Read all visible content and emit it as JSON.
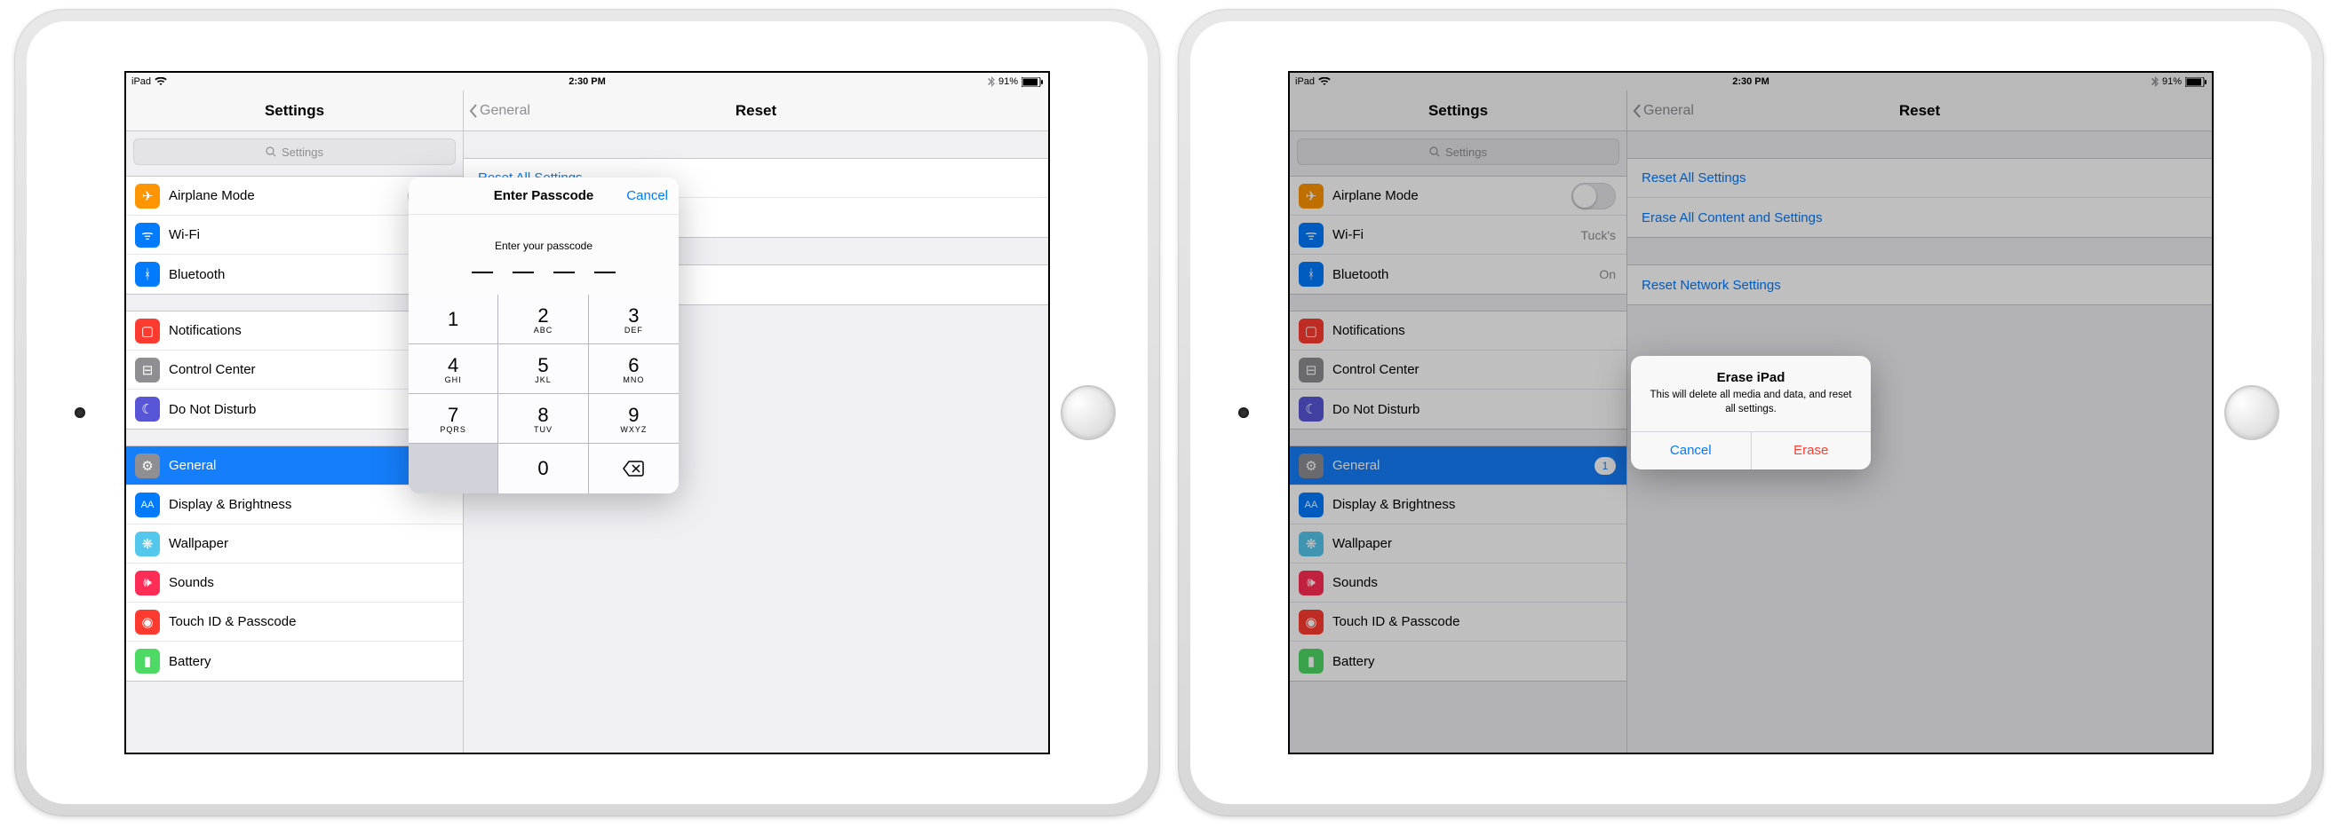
{
  "status": {
    "carrier": "iPad",
    "time": "2:30 PM",
    "battery": "91%"
  },
  "sidebar": {
    "title": "Settings",
    "search_placeholder": "Settings",
    "groups": [
      {
        "items": [
          {
            "icon": "airplane",
            "label": "Airplane Mode",
            "accessory": "switch"
          },
          {
            "icon": "wifi",
            "label": "Wi-Fi",
            "detail": "Tuck's"
          },
          {
            "icon": "bluetooth",
            "label": "Bluetooth",
            "detail": "On"
          }
        ]
      },
      {
        "items": [
          {
            "icon": "notif",
            "label": "Notifications"
          },
          {
            "icon": "control",
            "label": "Control Center"
          },
          {
            "icon": "dnd",
            "label": "Do Not Disturb"
          }
        ]
      },
      {
        "items": [
          {
            "icon": "general",
            "label": "General",
            "selected": true,
            "badge": "1"
          },
          {
            "icon": "display",
            "label": "Display & Brightness"
          },
          {
            "icon": "wallpaper",
            "label": "Wallpaper"
          },
          {
            "icon": "sounds",
            "label": "Sounds"
          },
          {
            "icon": "touchid",
            "label": "Touch ID & Passcode"
          },
          {
            "icon": "battery",
            "label": "Battery"
          }
        ]
      }
    ]
  },
  "main": {
    "back": "General",
    "title": "Reset",
    "sections": [
      [
        "Reset All Settings",
        "Erase All Content and Settings"
      ],
      [
        "Reset Network Settings"
      ]
    ]
  },
  "passcode": {
    "title": "Enter Passcode",
    "cancel": "Cancel",
    "message": "Enter your passcode",
    "keys": [
      {
        "n": "1",
        "s": ""
      },
      {
        "n": "2",
        "s": "ABC"
      },
      {
        "n": "3",
        "s": "DEF"
      },
      {
        "n": "4",
        "s": "GHI"
      },
      {
        "n": "5",
        "s": "JKL"
      },
      {
        "n": "6",
        "s": "MNO"
      },
      {
        "n": "7",
        "s": "PQRS"
      },
      {
        "n": "8",
        "s": "TUV"
      },
      {
        "n": "9",
        "s": "WXYZ"
      },
      {
        "blank": true
      },
      {
        "n": "0",
        "s": ""
      },
      {
        "back": true
      }
    ]
  },
  "alert": {
    "title": "Erase iPad",
    "message": "This will delete all media and data, and reset all settings.",
    "cancel": "Cancel",
    "confirm": "Erase"
  }
}
